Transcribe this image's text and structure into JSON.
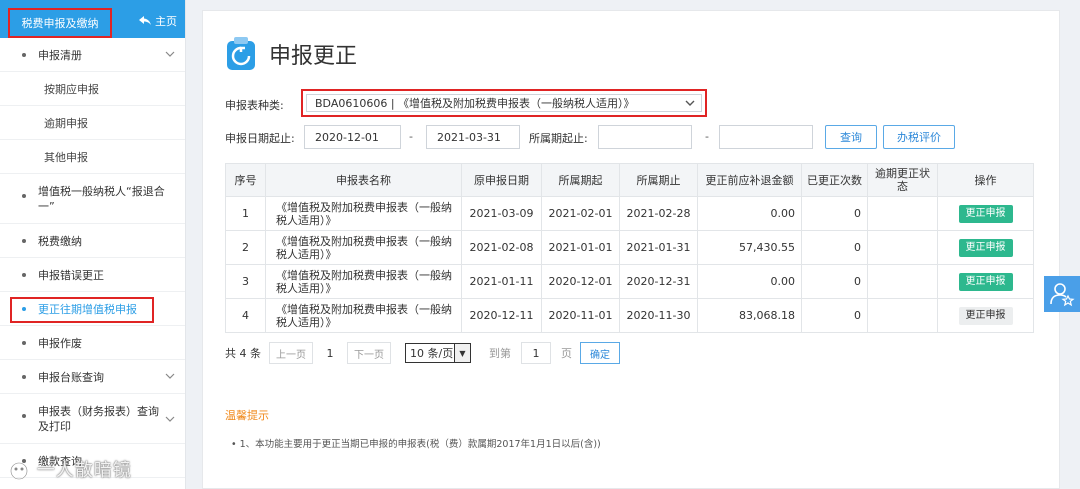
{
  "sidebar": {
    "header_title": "税费申报及缴纳",
    "home_label": "主页",
    "items": [
      {
        "label": "申报清册",
        "expandable": true
      },
      {
        "label": "按期应申报",
        "sub": true
      },
      {
        "label": "逾期申报",
        "sub": true
      },
      {
        "label": "其他申报",
        "sub": true
      },
      {
        "label": "增值税一般纳税人“报退合一”"
      },
      {
        "label": "税费缴纳"
      },
      {
        "label": "申报错误更正"
      },
      {
        "label": "更正往期增值税申报",
        "active": true
      },
      {
        "label": "申报作废"
      },
      {
        "label": "申报台账查询",
        "expandable": true
      },
      {
        "label": "申报表（财务报表）查询及打印",
        "expandable": true
      },
      {
        "label": "缴款查询"
      }
    ]
  },
  "watermark": "一人散暗镜",
  "main": {
    "title": "申报更正",
    "form": {
      "type_label": "申报表种类:",
      "type_value": "BDA0610606 | 《增值税及附加税费申报表（一般纳税人适用）》",
      "date_label": "申报日期起止:",
      "date_from": "2020-12-01",
      "date_to": "2021-03-31",
      "period_label": "所属期起止:",
      "period_from": "",
      "period_to": "",
      "dash": "-",
      "query_button": "查询",
      "evaluate_button": "办税评价"
    },
    "table": {
      "headers": [
        "序号",
        "申报表名称",
        "原申报日期",
        "所属期起",
        "所属期止",
        "更正前应补退金额",
        "已更正次数",
        "逾期更正状态",
        "操作"
      ],
      "rows": [
        {
          "no": "1",
          "name": "《增值税及附加税费申报表（一般纳税人适用）》",
          "date": "2021-03-09",
          "from": "2021-02-01",
          "to": "2021-02-28",
          "amount": "0.00",
          "count": "0",
          "status": "",
          "op": "更正申报",
          "op_style": "green"
        },
        {
          "no": "2",
          "name": "《增值税及附加税费申报表（一般纳税人适用）》",
          "date": "2021-02-08",
          "from": "2021-01-01",
          "to": "2021-01-31",
          "amount": "57,430.55",
          "count": "0",
          "status": "",
          "op": "更正申报",
          "op_style": "green"
        },
        {
          "no": "3",
          "name": "《增值税及附加税费申报表（一般纳税人适用）》",
          "date": "2021-01-11",
          "from": "2020-12-01",
          "to": "2020-12-31",
          "amount": "0.00",
          "count": "0",
          "status": "",
          "op": "更正申报",
          "op_style": "green"
        },
        {
          "no": "4",
          "name": "《增值税及附加税费申报表（一般纳税人适用）》",
          "date": "2020-12-11",
          "from": "2020-11-01",
          "to": "2020-11-30",
          "amount": "83,068.18",
          "count": "0",
          "status": "",
          "op": "更正申报",
          "op_style": "gray"
        }
      ]
    },
    "pager": {
      "total": "共 4 条",
      "prev": "上一页",
      "page": "1",
      "next": "下一页",
      "page_size": "10 条/页",
      "goto_label": "到第",
      "goto_value": "1",
      "page_unit": "页",
      "confirm": "确定"
    },
    "tips": {
      "title": "温馨提示",
      "text": "• 1、本功能主要用于更正当期已申报的申报表(税（费）款属期2017年1月1日以后(含))"
    }
  },
  "colors": {
    "brand": "#2c9ee6",
    "highlight": "#e02424",
    "success": "#2db88e",
    "tips": "#f08a1c"
  }
}
